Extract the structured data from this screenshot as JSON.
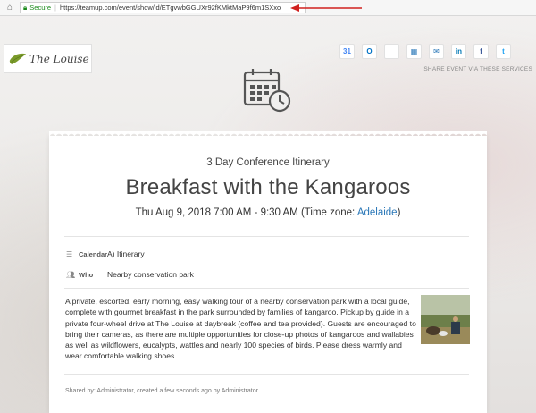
{
  "browser": {
    "secure_label": "Secure",
    "url": "https://teamup.com/event/show/id/ETgvwbGGUXr92fKMktMaP9f6m1SXxo"
  },
  "brand": {
    "logo_text": "The Louise"
  },
  "share": {
    "caption": "SHARE EVENT VIA THESE SERVICES",
    "icons": [
      {
        "name": "google-calendar-icon",
        "glyph": "31",
        "color": "#4285f4"
      },
      {
        "name": "outlook-icon",
        "glyph": "O",
        "color": "#0072c6"
      },
      {
        "name": "apple-icon",
        "glyph": "",
        "color": "#333333"
      },
      {
        "name": "ical-icon",
        "glyph": "▦",
        "color": "#2b78b8"
      },
      {
        "name": "email-icon",
        "glyph": "✉",
        "color": "#2b78b8"
      },
      {
        "name": "linkedin-icon",
        "glyph": "in",
        "color": "#0077b5"
      },
      {
        "name": "facebook-icon",
        "glyph": "f",
        "color": "#3b5998"
      },
      {
        "name": "twitter-icon",
        "glyph": "t",
        "color": "#1da1f2"
      }
    ]
  },
  "event": {
    "calendar_subtitle": "3 Day Conference Itinerary",
    "title": "Breakfast with the Kangaroos",
    "when": "Thu Aug 9, 2018 7:00 AM - 9:30 AM (Time zone: ",
    "timezone": "Adelaide",
    "when_suffix": ")",
    "calendar_label": "Calendar",
    "calendar_value": "A) Itinerary",
    "who_label": "Who",
    "who_value": "Nearby conservation park",
    "description": "A private, escorted, early morning, easy walking tour of a nearby conservation park with a local guide, complete with gourmet breakfast in the park surrounded by families of kangaroo. Pickup by guide in a private four-wheel drive at The Louise at daybreak (coffee and tea provided). Guests are encouraged to bring their cameras, as there are multiple opportunities for close-up photos of kangaroos and wallabies as well as wildflowers, eucalypts, wattles and nearly 100 species of birds. Please dress warmly and wear comfortable walking shoes.",
    "footer": "Shared by: Administrator, created a few seconds ago by Administrator"
  },
  "colors": {
    "link": "#2b78b8",
    "secure": "#1a8a1a",
    "arrow": "#d0201e"
  }
}
